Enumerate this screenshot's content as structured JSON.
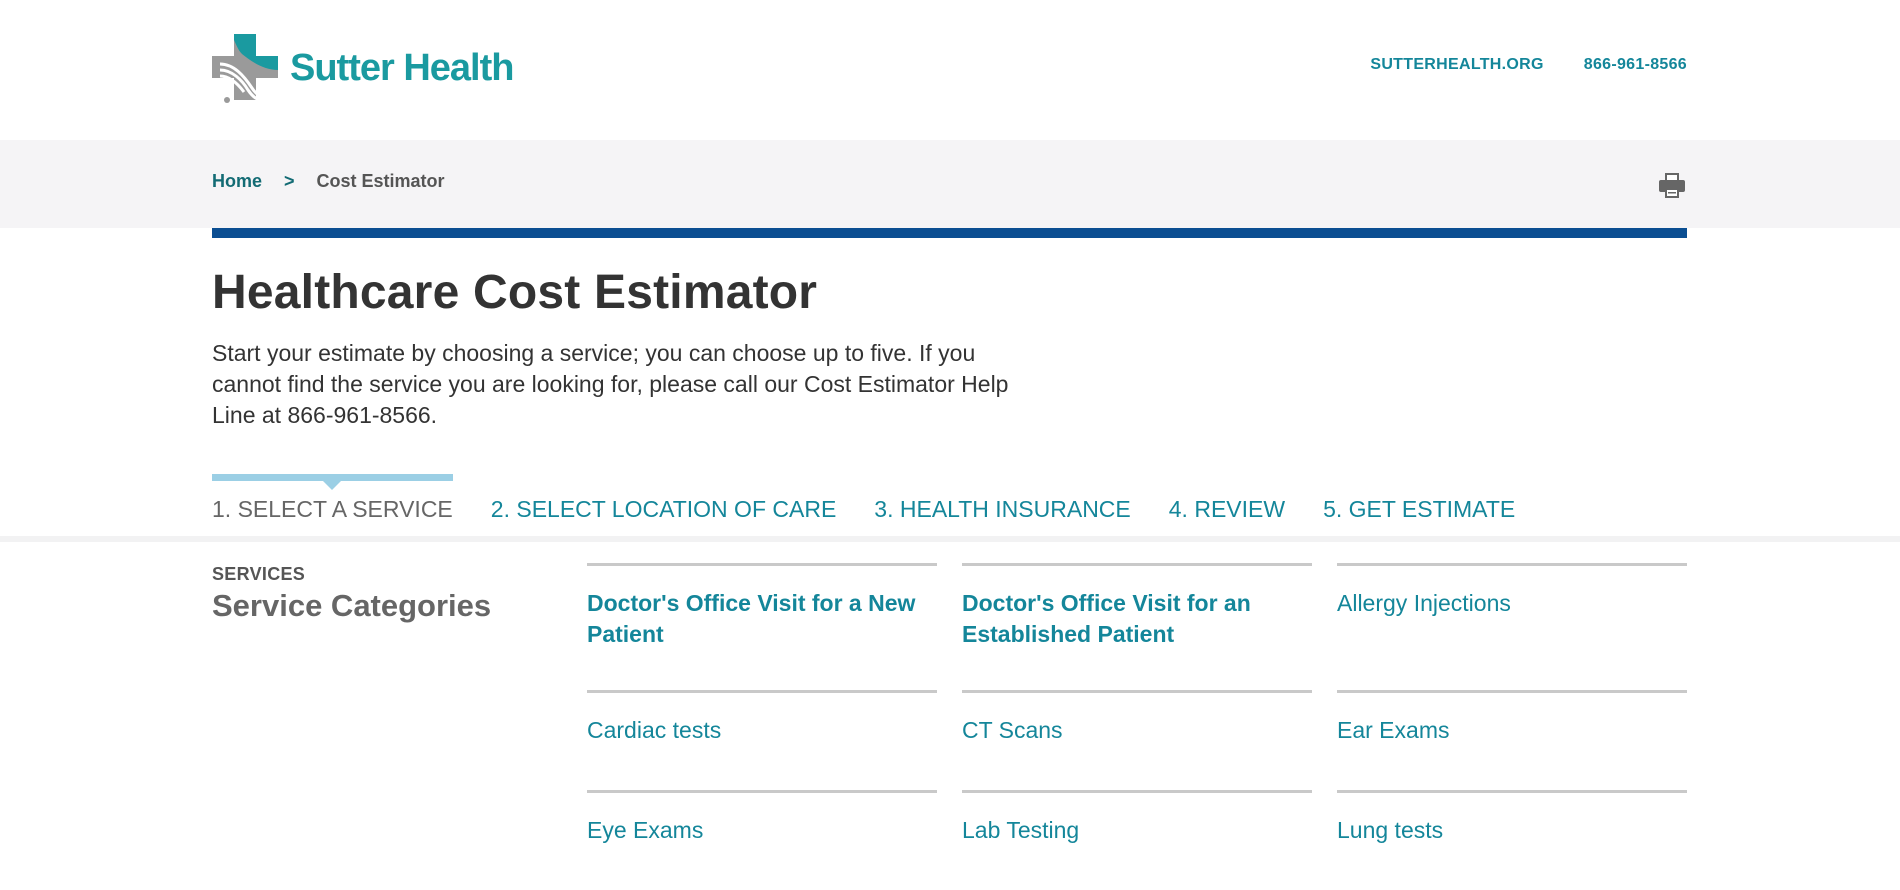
{
  "brand": {
    "name": "Sutter Health",
    "color": "#1a9aa0"
  },
  "top_links": [
    {
      "label": "SUTTERHEALTH.ORG"
    },
    {
      "label": "866-961-8566"
    }
  ],
  "breadcrumb": {
    "home": "Home",
    "separator": ">",
    "current": "Cost Estimator"
  },
  "page": {
    "title": "Healthcare Cost Estimator",
    "intro": "Start your estimate by choosing a service; you can choose up to five. If you cannot find the service you are looking for, please call our Cost Estimator Help Line at 866-961-8566."
  },
  "steps": [
    {
      "label": "1. SELECT A SERVICE",
      "active": true
    },
    {
      "label": "2. SELECT LOCATION OF CARE",
      "active": false
    },
    {
      "label": "3. HEALTH INSURANCE",
      "active": false
    },
    {
      "label": "4. REVIEW",
      "active": false
    },
    {
      "label": "5. GET ESTIMATE",
      "active": false
    }
  ],
  "services": {
    "label": "SERVICES",
    "heading": "Service Categories",
    "items": [
      {
        "label": "Doctor's Office Visit for a New Patient",
        "bold": true
      },
      {
        "label": "Doctor's Office Visit for an Established Patient",
        "bold": true
      },
      {
        "label": "Allergy Injections",
        "bold": false
      },
      {
        "label": "Cardiac tests",
        "bold": false
      },
      {
        "label": "CT Scans",
        "bold": false
      },
      {
        "label": "Ear Exams",
        "bold": false
      },
      {
        "label": "Eye Exams",
        "bold": false
      },
      {
        "label": "Lab Testing",
        "bold": false
      },
      {
        "label": "Lung tests",
        "bold": false
      }
    ]
  },
  "colors": {
    "accent_teal": "#14869a",
    "nav_rule_blue": "#0b4e92",
    "active_step_bar": "#9bcfe5"
  }
}
